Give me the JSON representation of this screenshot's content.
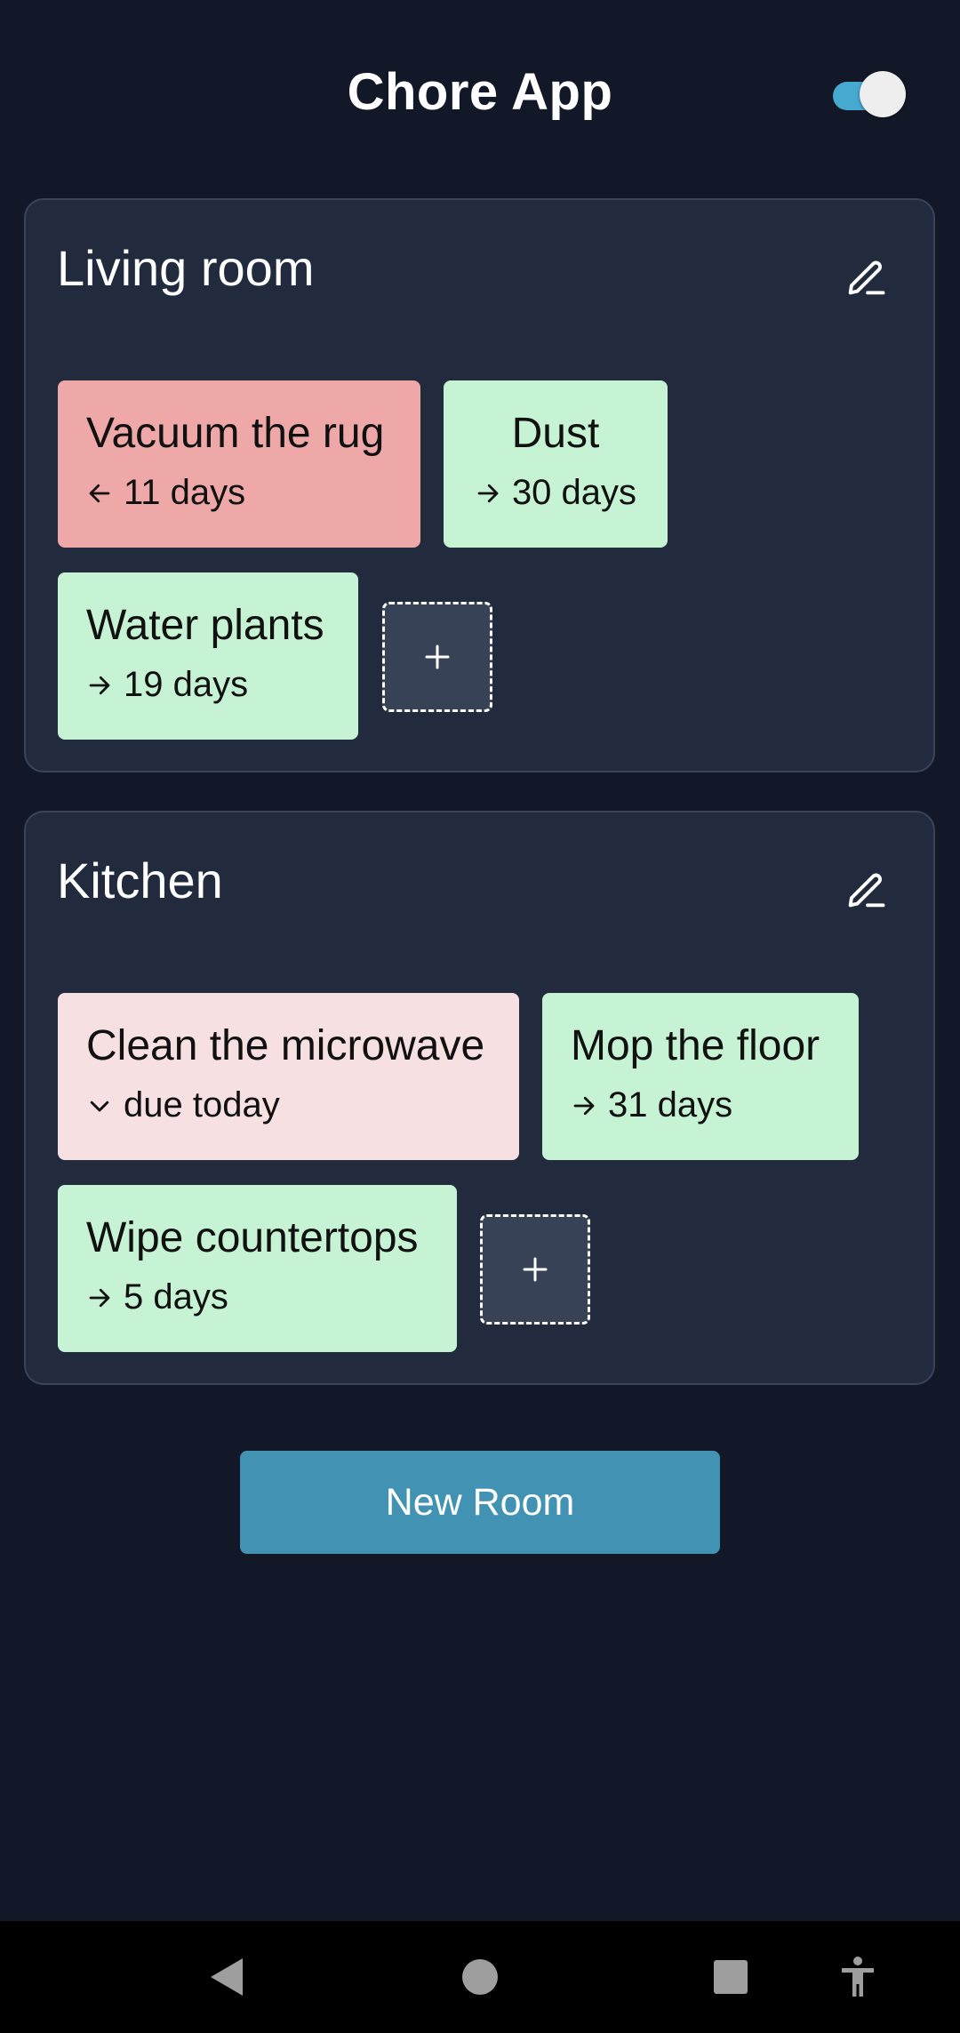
{
  "app": {
    "title": "Chore App",
    "dark_mode_toggle": true,
    "colors": {
      "background": "#131829",
      "card": "#222b3e",
      "chore_ok": "#c6f3d4",
      "chore_overdue": "#eda8a7",
      "chore_due_today": "#f7e0e2",
      "accent": "#46a9cf",
      "button": "#4293b3"
    }
  },
  "rooms": [
    {
      "name": "Living room",
      "edit_icon": "pencil-icon",
      "chores": [
        {
          "name": "Vacuum the rug",
          "status": "overdue",
          "icon": "arrow-left-icon",
          "due": "11 days"
        },
        {
          "name": "Dust",
          "status": "ok",
          "icon": "arrow-right-icon",
          "due": "30 days"
        },
        {
          "name": "Water plants",
          "status": "ok",
          "icon": "arrow-right-icon",
          "due": "19 days"
        }
      ],
      "add_label": "+"
    },
    {
      "name": "Kitchen",
      "edit_icon": "pencil-icon",
      "chores": [
        {
          "name": "Clean the microwave",
          "status": "today",
          "icon": "chevron-down-icon",
          "due": "due today"
        },
        {
          "name": "Mop the floor",
          "status": "ok",
          "icon": "arrow-right-icon",
          "due": "31 days"
        },
        {
          "name": "Wipe countertops",
          "status": "ok",
          "icon": "arrow-right-icon",
          "due": "5 days"
        }
      ],
      "add_label": "+"
    }
  ],
  "actions": {
    "new_room_label": "New Room"
  },
  "navbar": {
    "icons": [
      "back-icon",
      "home-icon",
      "recents-icon",
      "accessibility-icon"
    ]
  }
}
